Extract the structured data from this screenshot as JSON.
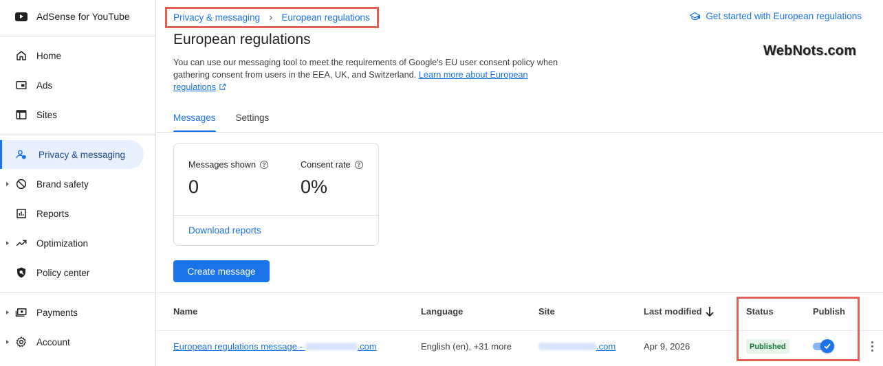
{
  "sidebar": {
    "brand": "AdSense for YouTube",
    "items": [
      {
        "label": "Home",
        "icon": "home-icon"
      },
      {
        "label": "Ads",
        "icon": "ads-icon"
      },
      {
        "label": "Sites",
        "icon": "sites-icon"
      },
      {
        "label": "Privacy & messaging",
        "icon": "privacy-icon",
        "active": true
      },
      {
        "label": "Brand safety",
        "icon": "block-icon",
        "expandable": true
      },
      {
        "label": "Reports",
        "icon": "reports-icon"
      },
      {
        "label": "Optimization",
        "icon": "trending-icon",
        "expandable": true
      },
      {
        "label": "Policy center",
        "icon": "policy-shield-icon"
      },
      {
        "label": "Payments",
        "icon": "payments-icon",
        "expandable": true
      },
      {
        "label": "Account",
        "icon": "gear-icon",
        "expandable": true
      }
    ]
  },
  "breadcrumb": {
    "parent": "Privacy & messaging",
    "current": "European regulations"
  },
  "header": {
    "get_started": "Get started with European regulations",
    "title": "European regulations",
    "watermark": "WebNots.com",
    "description": "You can use our messaging tool to meet the requirements of Google's EU user consent policy when gathering consent from users in the EEA, UK, and Switzerland.",
    "learn_more": "Learn more about European regulations"
  },
  "tabs": [
    {
      "label": "Messages",
      "active": true
    },
    {
      "label": "Settings",
      "active": false
    }
  ],
  "metrics": {
    "messages_shown_label": "Messages shown",
    "messages_shown_value": "0",
    "consent_rate_label": "Consent rate",
    "consent_rate_value": "0%",
    "download_label": "Download reports"
  },
  "create_button": "Create message",
  "table": {
    "columns": [
      "Name",
      "Language",
      "Site",
      "Last modified",
      "Status",
      "Publish"
    ],
    "rows": [
      {
        "name_prefix": "European regulations message - ",
        "name_suffix": ".com",
        "language": "English (en), +31 more",
        "site_suffix": ".com",
        "last_modified": "Apr 9, 2026",
        "status": "Published",
        "publish": true
      }
    ]
  },
  "colors": {
    "accent": "#1a73e8",
    "highlight": "#e06055",
    "published_bg": "#e6f4ea",
    "published_text": "#137333"
  }
}
